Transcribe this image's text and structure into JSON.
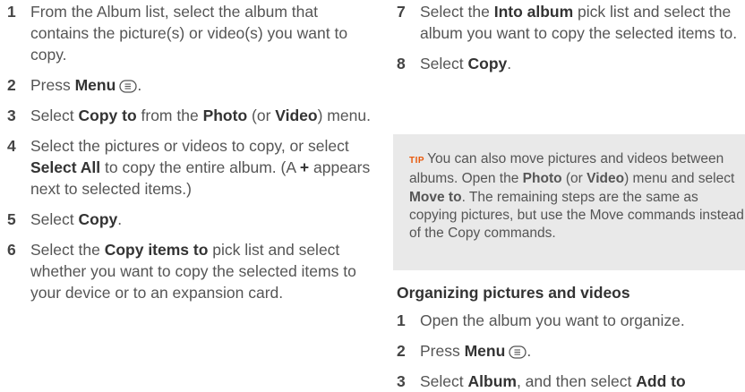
{
  "left_steps": [
    {
      "num": "1",
      "parts": [
        {
          "t": "From the Album list, select the album that contains the picture(s) or video(s) you want to copy."
        }
      ]
    },
    {
      "num": "2",
      "parts": [
        {
          "t": "Press "
        },
        {
          "t": "Menu",
          "b": true
        },
        {
          "icon": "menu-icon"
        },
        {
          "t": "."
        }
      ]
    },
    {
      "num": "3",
      "parts": [
        {
          "t": "Select "
        },
        {
          "t": "Copy to",
          "b": true
        },
        {
          "t": " from the "
        },
        {
          "t": "Photo",
          "b": true
        },
        {
          "t": " (or "
        },
        {
          "t": "Video",
          "b": true
        },
        {
          "t": ") menu."
        }
      ]
    },
    {
      "num": "4",
      "parts": [
        {
          "t": "Select the pictures or videos to copy, or select "
        },
        {
          "t": "Select All",
          "b": true
        },
        {
          "t": " to copy the entire album. (A "
        },
        {
          "t": "+",
          "b": true
        },
        {
          "t": " appears next to selected items.)"
        }
      ]
    },
    {
      "num": "5",
      "parts": [
        {
          "t": "Select "
        },
        {
          "t": "Copy",
          "b": true
        },
        {
          "t": "."
        }
      ]
    },
    {
      "num": "6",
      "parts": [
        {
          "t": "Select the "
        },
        {
          "t": "Copy items to",
          "b": true
        },
        {
          "t": " pick list and select whether you want to copy the selected items to your device or to an expansion card."
        }
      ]
    }
  ],
  "right_steps": [
    {
      "num": "7",
      "parts": [
        {
          "t": "Select the "
        },
        {
          "t": "Into album",
          "b": true
        },
        {
          "t": " pick list and select the album you want to copy the selected items to."
        }
      ]
    },
    {
      "num": "8",
      "parts": [
        {
          "t": "Select "
        },
        {
          "t": "Copy",
          "b": true
        },
        {
          "t": "."
        }
      ]
    }
  ],
  "tip": {
    "label": "TIP",
    "parts": [
      {
        "t": "You can also move pictures and videos between albums. Open the "
      },
      {
        "t": "Photo",
        "b": true
      },
      {
        "t": " (or "
      },
      {
        "t": "Video",
        "b": true
      },
      {
        "t": ") menu and select "
      },
      {
        "t": "Move to",
        "b": true
      },
      {
        "t": ". The remaining steps are the same as copying pictures, but use the Move commands instead of the Copy commands."
      }
    ]
  },
  "section_heading": "Organizing pictures and videos",
  "section_steps": [
    {
      "num": "1",
      "parts": [
        {
          "t": "Open the album you want to organize."
        }
      ]
    },
    {
      "num": "2",
      "parts": [
        {
          "t": "Press "
        },
        {
          "t": "Menu",
          "b": true
        },
        {
          "icon": "menu-icon"
        },
        {
          "t": "."
        }
      ]
    },
    {
      "num": "3",
      "parts": [
        {
          "t": "Select "
        },
        {
          "t": "Album",
          "b": true
        },
        {
          "t": ", and then select "
        },
        {
          "t": "Add to",
          "b": true
        }
      ]
    }
  ]
}
